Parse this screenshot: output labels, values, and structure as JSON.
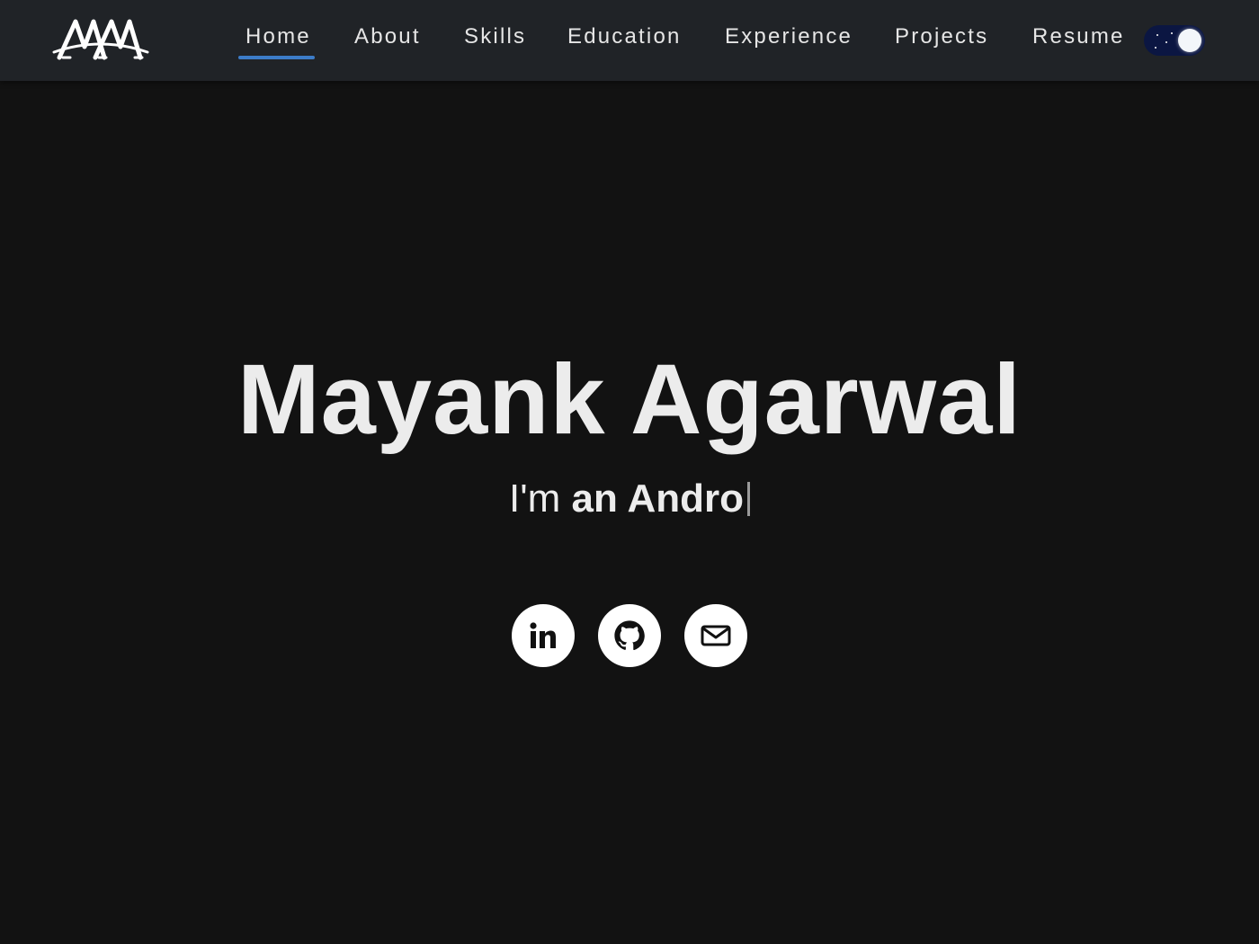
{
  "nav": {
    "logo_icon": "ma-monogram-logo-icon",
    "links": [
      {
        "label": "Home",
        "active": true
      },
      {
        "label": "About",
        "active": false
      },
      {
        "label": "Skills",
        "active": false
      },
      {
        "label": "Education",
        "active": false
      },
      {
        "label": "Experience",
        "active": false
      },
      {
        "label": "Projects",
        "active": false
      },
      {
        "label": "Resume",
        "active": false
      }
    ],
    "theme_toggle": {
      "icon": "moon-night-toggle-icon",
      "mode": "dark"
    },
    "active_color": "#3c7cc8"
  },
  "hero": {
    "name": "Mayank Agarwal",
    "tagline_prefix": "I'm ",
    "tagline_typed": "an Andro"
  },
  "social": [
    {
      "icon": "linkedin-icon"
    },
    {
      "icon": "github-icon"
    },
    {
      "icon": "email-icon"
    }
  ],
  "colors": {
    "background": "#121212",
    "navbar": "#202327",
    "text": "#ececec"
  }
}
